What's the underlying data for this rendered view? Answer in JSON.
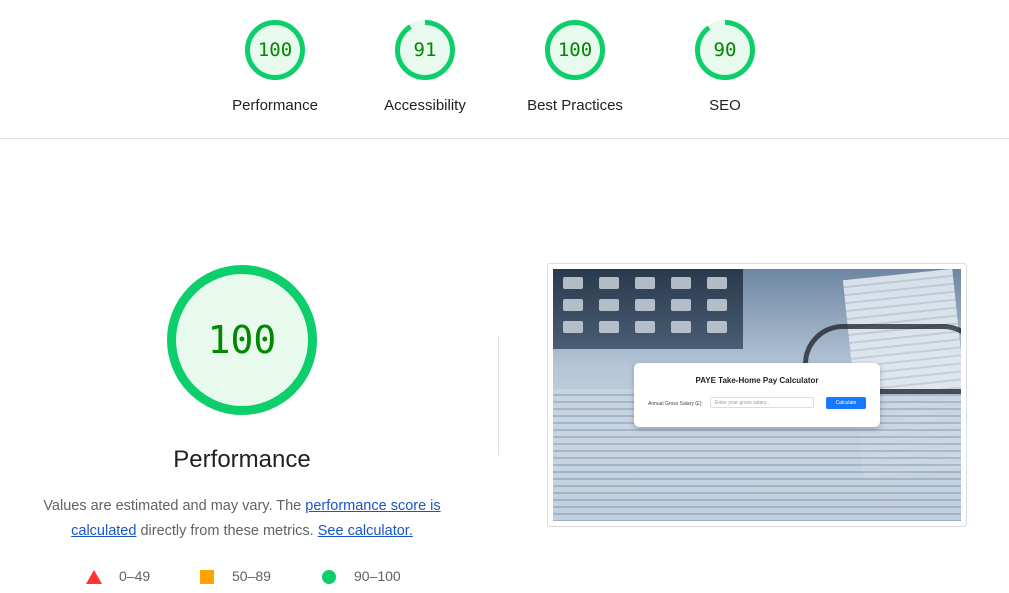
{
  "colors": {
    "pass": "#0cce6b",
    "pass_fill": "#e8f9ee",
    "pass_text": "#008800",
    "average": "#ffa400",
    "fail": "#ff3333",
    "link": "#1a55c5"
  },
  "categories": [
    {
      "score": "100",
      "label": "Performance",
      "fraction": 1.0
    },
    {
      "score": "91",
      "label": "Accessibility",
      "fraction": 0.91
    },
    {
      "score": "100",
      "label": "Best Practices",
      "fraction": 1.0
    },
    {
      "score": "90",
      "label": "SEO",
      "fraction": 0.9
    }
  ],
  "performance": {
    "score": "100",
    "fraction": 1.0,
    "title": "Performance",
    "desc_prefix": "Values are estimated and may vary. The ",
    "desc_link": "performance score is calculated",
    "desc_middle": " directly from these metrics. ",
    "desc_calc_link": "See calculator."
  },
  "legend": {
    "fail": "0–49",
    "average": "50–89",
    "pass": "90–100",
    "fail_icon": "triangle-icon",
    "average_icon": "square-icon",
    "pass_icon": "circle-icon"
  },
  "screenshot": {
    "title": "PAYE Take-Home Pay Calculator",
    "field_label": "Annual Gross Salary (£):",
    "placeholder": "Enter your gross salary...",
    "button": "Calculate"
  }
}
